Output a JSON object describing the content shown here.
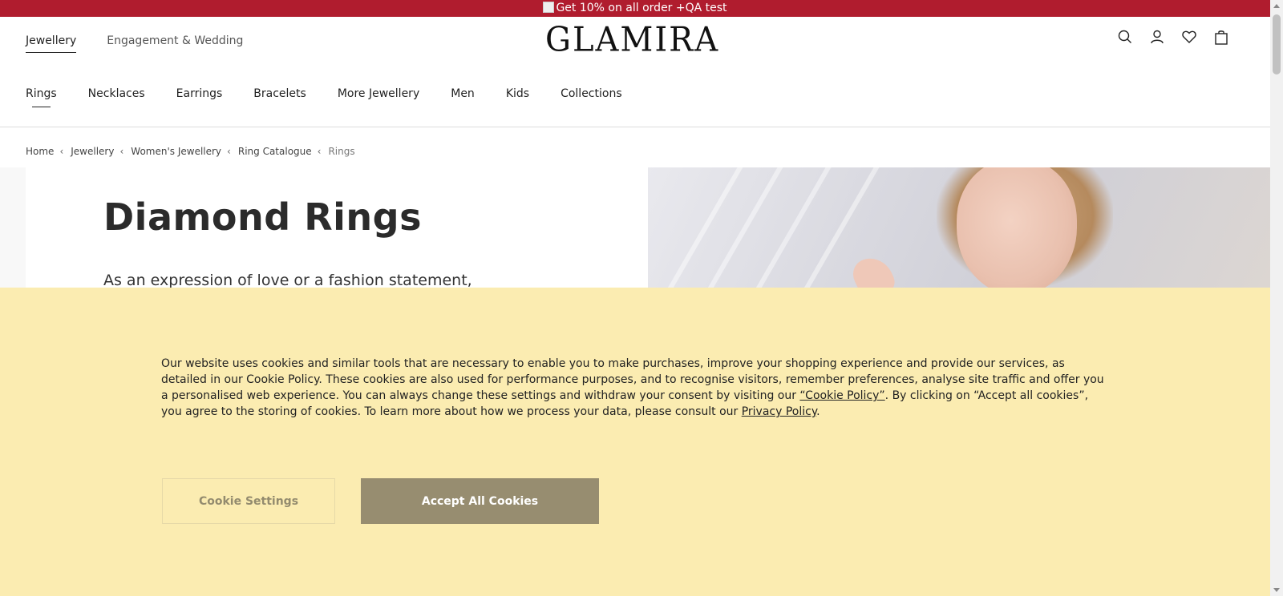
{
  "promo": {
    "text": "Get 10% on all order +QA test"
  },
  "header": {
    "logo": "GLAMIRA",
    "top_nav": [
      "Jewellery",
      "Engagement & Wedding"
    ],
    "categories": [
      "Rings",
      "Necklaces",
      "Earrings",
      "Bracelets",
      "More Jewellery",
      "Men",
      "Kids",
      "Collections"
    ],
    "icons": [
      "search-icon",
      "account-icon",
      "wishlist-heart-icon",
      "shopping-bag-icon"
    ]
  },
  "breadcrumb": {
    "items": [
      "Home",
      "Jewellery",
      "Women's Jewellery",
      "Ring Catalogue"
    ],
    "current": "Rings"
  },
  "hero": {
    "title": "Diamond Rings",
    "subtitle": "As an expression of love or a fashion statement,"
  },
  "cookie": {
    "text_part1": "Our website uses cookies and similar tools that are necessary to enable you to make purchases, improve your shopping experience and provide our services, as detailed in our Cookie Policy. These cookies are also used for performance purposes, and to recognise visitors, remember preferences, analyse site traffic and offer you a personalised web experience. You can always change these settings and withdraw your consent by visiting our ",
    "cookie_policy_link": "“Cookie Policy”",
    "text_part2": ". By clicking on “Accept all cookies”, you agree to the storing of cookies. To learn more about how we process your data, please consult our ",
    "privacy_link": "Privacy Policy",
    "text_part3": ".",
    "settings_button": "Cookie Settings",
    "accept_button": "Accept All Cookies"
  },
  "colors": {
    "promo_bar": "#b01c2e",
    "cookie_banner": "#fbecb1",
    "accept_button": "#978d70"
  }
}
